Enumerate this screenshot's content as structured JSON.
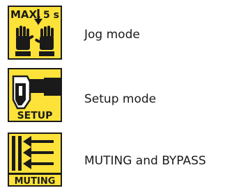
{
  "items": [
    {
      "icon": "two-hand-jog-icon",
      "icon_text": {
        "left": "MAX.",
        "right": "5 s"
      },
      "label": "Jog mode"
    },
    {
      "icon": "handheld-enabling-device-icon",
      "icon_text": {
        "bottom": "SETUP"
      },
      "label": "Setup mode"
    },
    {
      "icon": "muting-arrows-icon",
      "icon_text": {
        "bottom": "MUTING"
      },
      "label": "MUTING and BYPASS"
    }
  ],
  "colors": {
    "icon_background": "#fde23a",
    "icon_foreground": "#1a1a1a"
  }
}
